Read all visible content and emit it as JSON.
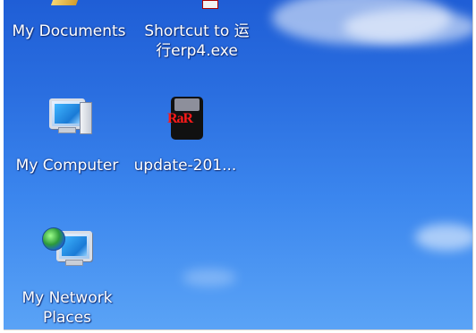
{
  "desktop": {
    "icons": [
      {
        "id": "my-documents",
        "label": "My Documents",
        "icon": "folder-documents-icon"
      },
      {
        "id": "shortcut-erp4",
        "label": "Shortcut to 运行erp4.exe",
        "line1": "Shortcut to 运",
        "line2": "行erp4.exe",
        "icon": "shortcut-exe-icon"
      },
      {
        "id": "my-computer",
        "label": "My Computer",
        "icon": "computer-icon"
      },
      {
        "id": "update-rar",
        "label": "update-201...",
        "icon": "rar-archive-icon"
      },
      {
        "id": "my-network-places",
        "label": "My Network Places",
        "line1": "My Network",
        "line2": "Places",
        "icon": "network-places-icon"
      }
    ],
    "colors": {
      "sky_top": "#1f5ed6",
      "sky_bottom": "#5aa3f6",
      "label_text": "#ffffff"
    }
  }
}
